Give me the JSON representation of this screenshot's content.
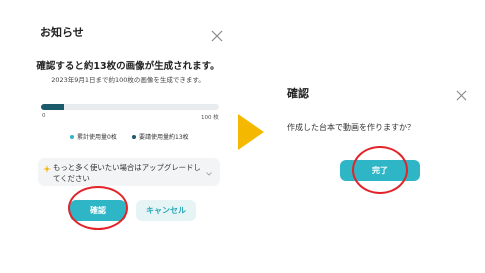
{
  "left_dialog": {
    "title": "お知らせ",
    "headline": "確認すると約13枚の画像が生成されます。",
    "subtext": "2023年9月1日まで約100枚の画像を生成できます。",
    "usage": {
      "current": 0,
      "max": 100,
      "progress_fraction": 0.13,
      "min_label": "0",
      "max_label": "100 枚"
    },
    "legend": [
      {
        "label": "累計使用量0枚",
        "color": "#2fb6c6"
      },
      {
        "label": "要請使用量約13枚",
        "color": "#1b5a6a"
      }
    ],
    "notice_icon": "sparkle-icon",
    "notice_text": "もっと多く使いたい場合はアップグレードしてください",
    "confirm_label": "確認",
    "cancel_label": "キャンセル"
  },
  "right_dialog": {
    "title": "確認",
    "question": "作成した台本で動画を作りますか？",
    "complete_label": "完了"
  },
  "colors": {
    "primary": "#2fb6c6",
    "dark_fill": "#1b5a6a",
    "arrow": "#f5b800",
    "highlight_ring": "#e2242a"
  }
}
